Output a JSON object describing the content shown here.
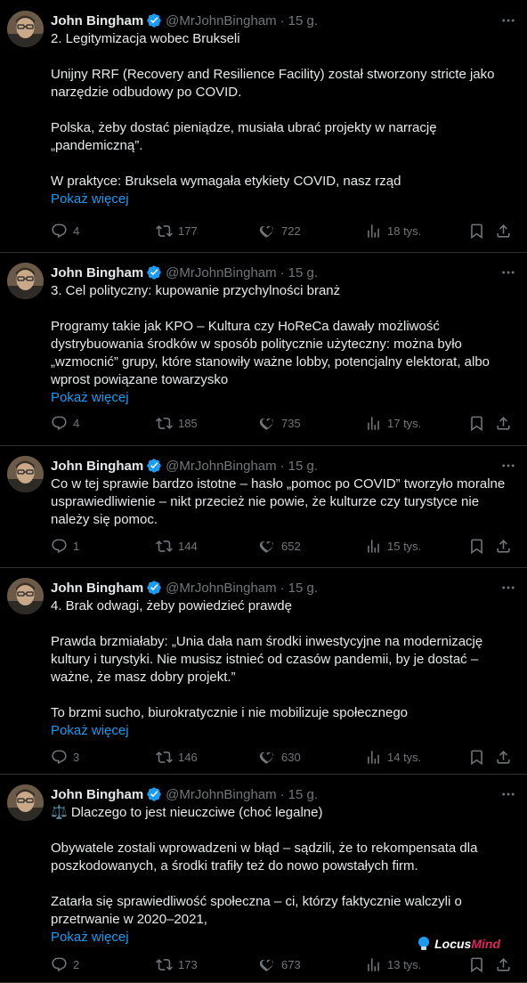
{
  "tweets": [
    {
      "name": "John Bingham",
      "handle": "@MrJohnBingham",
      "time": "15 g.",
      "paragraphs": [
        "2. Legitymizacja wobec Brukseli",
        "Unijny RRF (Recovery and Resilience Facility) został stworzony stricte jako narzędzie odbudowy po COVID.",
        "Polska, żeby dostać pieniądze, musiała ubrać projekty w narrację „pandemiczną”.",
        "W praktyce: Bruksela wymagała etykiety COVID, nasz rząd"
      ],
      "show_more": "Pokaż więcej",
      "replies": "4",
      "retweets": "177",
      "likes": "722",
      "views": "18 tys."
    },
    {
      "name": "John Bingham",
      "handle": "@MrJohnBingham",
      "time": "15 g.",
      "paragraphs": [
        "3. Cel polityczny: kupowanie przychylności branż",
        "Programy takie jak KPO – Kultura czy HoReCa dawały możliwość dystrybuowania środków w sposób politycznie użyteczny: można było „wzmocnić” grupy, które stanowiły ważne lobby, potencjalny elektorat, albo wprost powiązane towarzysko"
      ],
      "show_more": "Pokaż więcej",
      "replies": "4",
      "retweets": "185",
      "likes": "735",
      "views": "17 tys."
    },
    {
      "name": "John Bingham",
      "handle": "@MrJohnBingham",
      "time": "15 g.",
      "paragraphs": [
        "Co w tej sprawie bardzo istotne – hasło „pomoc po COVID” tworzyło moralne usprawiedliwienie – nikt przecież nie powie, że kulturze czy turystyce nie należy się pomoc."
      ],
      "show_more": "",
      "replies": "1",
      "retweets": "144",
      "likes": "652",
      "views": "15 tys."
    },
    {
      "name": "John Bingham",
      "handle": "@MrJohnBingham",
      "time": "15 g.",
      "paragraphs": [
        "4. Brak odwagi, żeby powiedzieć prawdę",
        "Prawda brzmiałaby: „Unia dała nam środki inwestycyjne na modernizację kultury i turystyki. Nie musisz istnieć od czasów pandemii, by je dostać – ważne, że masz dobry projekt.”",
        "To brzmi sucho, biurokratycznie i nie mobilizuje społecznego"
      ],
      "show_more": "Pokaż więcej",
      "replies": "3",
      "retweets": "146",
      "likes": "630",
      "views": "14 tys."
    },
    {
      "name": "John Bingham",
      "handle": "@MrJohnBingham",
      "time": "15 g.",
      "paragraphs": [
        "⚖️ Dlaczego to jest nieuczciwe (choć legalne)",
        "Obywatele zostali wprowadzeni w błąd – sądzili, że to rekompensata dla poszkodowanych, a środki trafiły też do nowo powstałych firm.",
        "Zatarła się sprawiedliwość społeczna – ci, którzy faktycznie walczyli o przetrwanie w 2020–2021,"
      ],
      "show_more": "Pokaż więcej",
      "replies": "2",
      "retweets": "173",
      "likes": "673",
      "views": "13 tys."
    }
  ],
  "watermark": {
    "part1": "Locus",
    "part2": "Mind"
  },
  "colors": {
    "bg": "#000000",
    "text": "#e7e9ea",
    "muted": "#71767b",
    "link": "#1d9bf0",
    "verified": "#1d9bf0"
  }
}
